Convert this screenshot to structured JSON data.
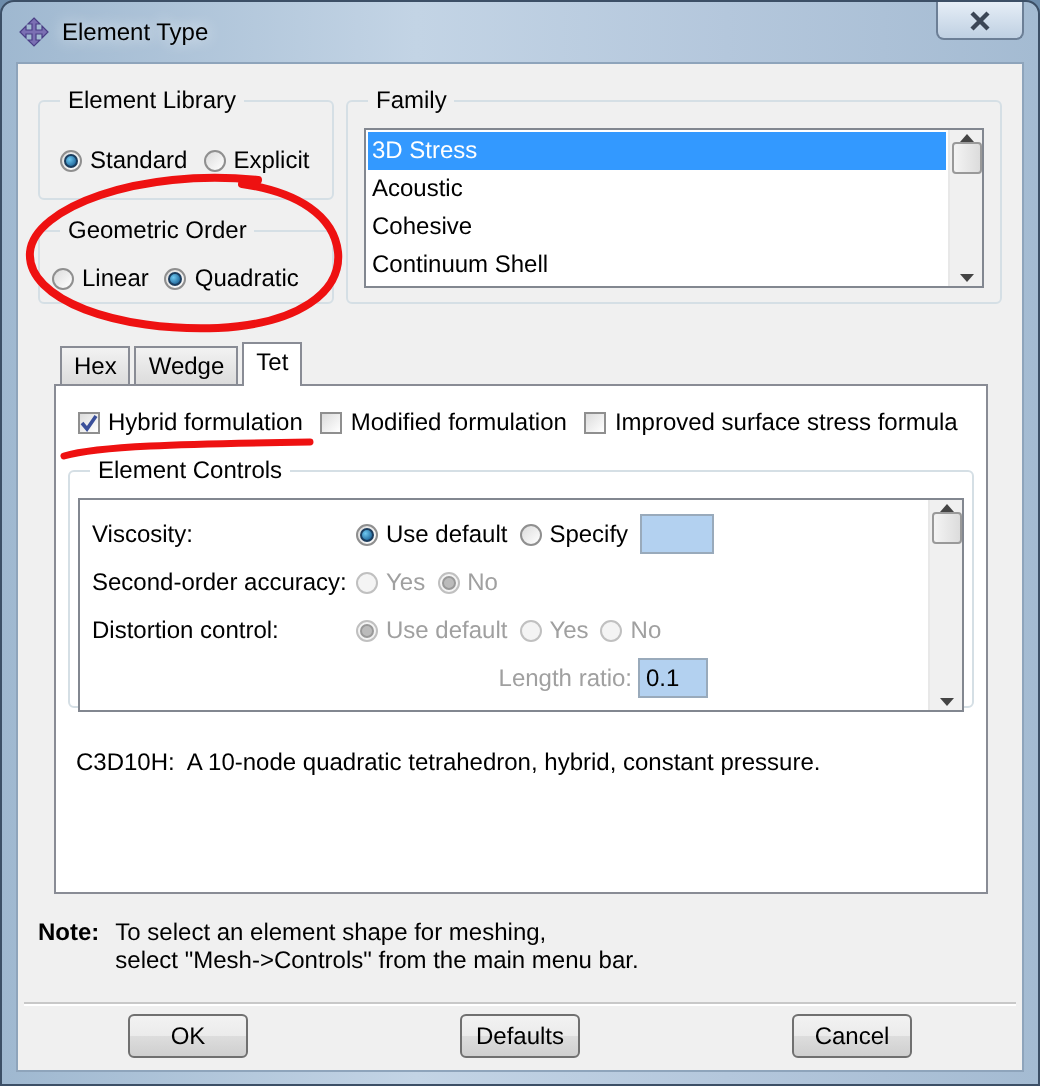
{
  "window": {
    "title": "Element Type"
  },
  "element_library": {
    "title": "Element Library",
    "options": [
      {
        "label": "Standard",
        "selected": true
      },
      {
        "label": "Explicit",
        "selected": false
      }
    ]
  },
  "geometric_order": {
    "title": "Geometric Order",
    "circled": true,
    "options": [
      {
        "label": "Linear",
        "selected": false
      },
      {
        "label": "Quadratic",
        "selected": true
      }
    ]
  },
  "family": {
    "title": "Family",
    "items": [
      {
        "label": "3D Stress",
        "selected": true
      },
      {
        "label": "Acoustic",
        "selected": false
      },
      {
        "label": "Cohesive",
        "selected": false
      },
      {
        "label": "Continuum Shell",
        "selected": false
      }
    ]
  },
  "tabs": [
    {
      "label": "Hex",
      "selected": false
    },
    {
      "label": "Wedge",
      "selected": false
    },
    {
      "label": "Tet",
      "selected": true
    }
  ],
  "formulations": [
    {
      "label": "Hybrid formulation",
      "checked": true,
      "underlined": true
    },
    {
      "label": "Modified formulation",
      "checked": false,
      "underlined": false
    },
    {
      "label": "Improved surface stress formula",
      "checked": false,
      "underlined": false
    }
  ],
  "element_controls": {
    "title": "Element Controls",
    "rows": [
      {
        "kind": "options",
        "label": "Viscosity:",
        "items": [
          {
            "kind": "radio",
            "label": "Use default",
            "selected": true,
            "disabled": false
          },
          {
            "kind": "radio",
            "label": "Specify",
            "selected": false,
            "disabled": false
          },
          {
            "kind": "field"
          }
        ]
      },
      {
        "kind": "options",
        "label": "Second-order accuracy:",
        "items": [
          {
            "kind": "radio",
            "label": "Yes",
            "selected": false,
            "disabled": true
          },
          {
            "kind": "radio",
            "label": "No",
            "selected": true,
            "disabled": true
          }
        ]
      },
      {
        "kind": "options",
        "label": "Distortion control:",
        "items": [
          {
            "kind": "radio",
            "label": "Use default",
            "selected": true,
            "disabled": true
          },
          {
            "kind": "radio",
            "label": "Yes",
            "selected": false,
            "disabled": true
          },
          {
            "kind": "radio",
            "label": "No",
            "selected": false,
            "disabled": true
          }
        ]
      },
      {
        "kind": "labeled_field",
        "label": "Length ratio:",
        "disabled": true,
        "value": "0.1"
      }
    ]
  },
  "description": "C3D10H:  A 10-node quadratic tetrahedron, hybrid, constant pressure.",
  "note": {
    "label": "Note:",
    "lines": [
      "To select an element shape for meshing,",
      "select \"Mesh->Controls\" from the main menu bar."
    ]
  },
  "buttons": [
    "OK",
    "Defaults",
    "Cancel"
  ]
}
